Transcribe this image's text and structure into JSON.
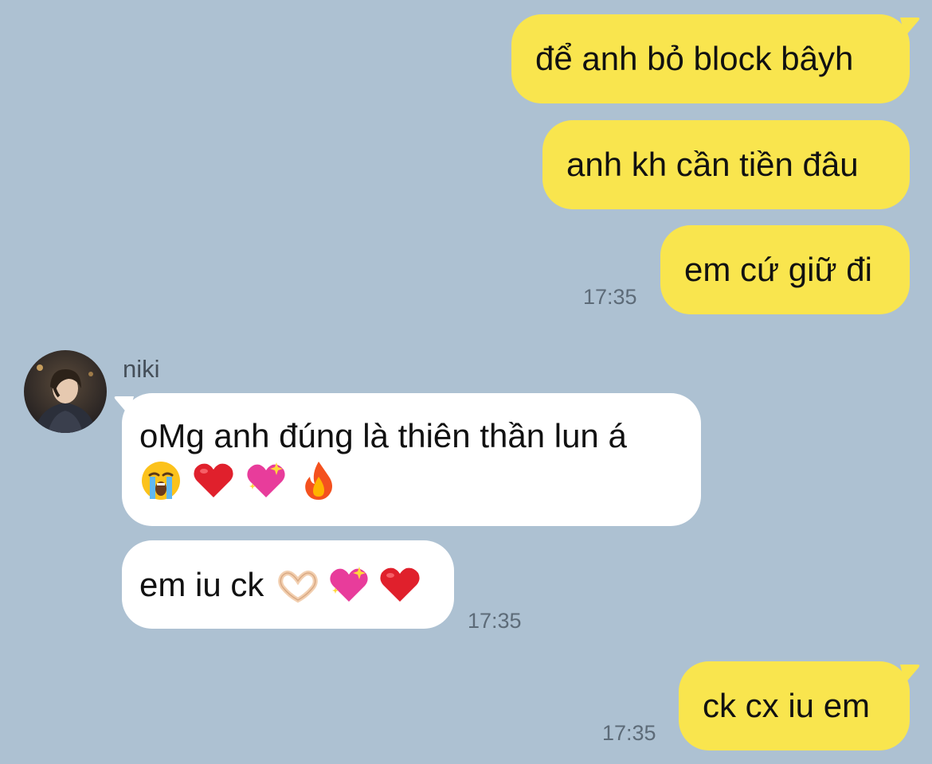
{
  "chat": {
    "contact_name": "niki",
    "messages": [
      {
        "id": "m1",
        "direction": "outgoing",
        "text": "để anh bỏ block bâyh"
      },
      {
        "id": "m2",
        "direction": "outgoing",
        "text": "anh kh cần tiền đâu"
      },
      {
        "id": "m3",
        "direction": "outgoing",
        "text": "em cứ giữ đi",
        "time": "17:35"
      },
      {
        "id": "m4",
        "direction": "incoming",
        "sender": "niki",
        "text": "oMg anh đúng là thiên thần lun á",
        "emojis": [
          "loudly-crying-face",
          "red-heart",
          "sparkling-heart",
          "fire"
        ]
      },
      {
        "id": "m5",
        "direction": "incoming",
        "text": "em iu ck",
        "emojis": [
          "heart-hands",
          "sparkling-heart",
          "red-heart"
        ],
        "time": "17:35"
      },
      {
        "id": "m6",
        "direction": "outgoing",
        "text": "ck cx iu em",
        "time": "17:35"
      }
    ]
  },
  "colors": {
    "background": "#adc1d2",
    "outgoing_bubble": "#f9e54e",
    "incoming_bubble": "#ffffff",
    "timestamp": "#5d6b78"
  }
}
